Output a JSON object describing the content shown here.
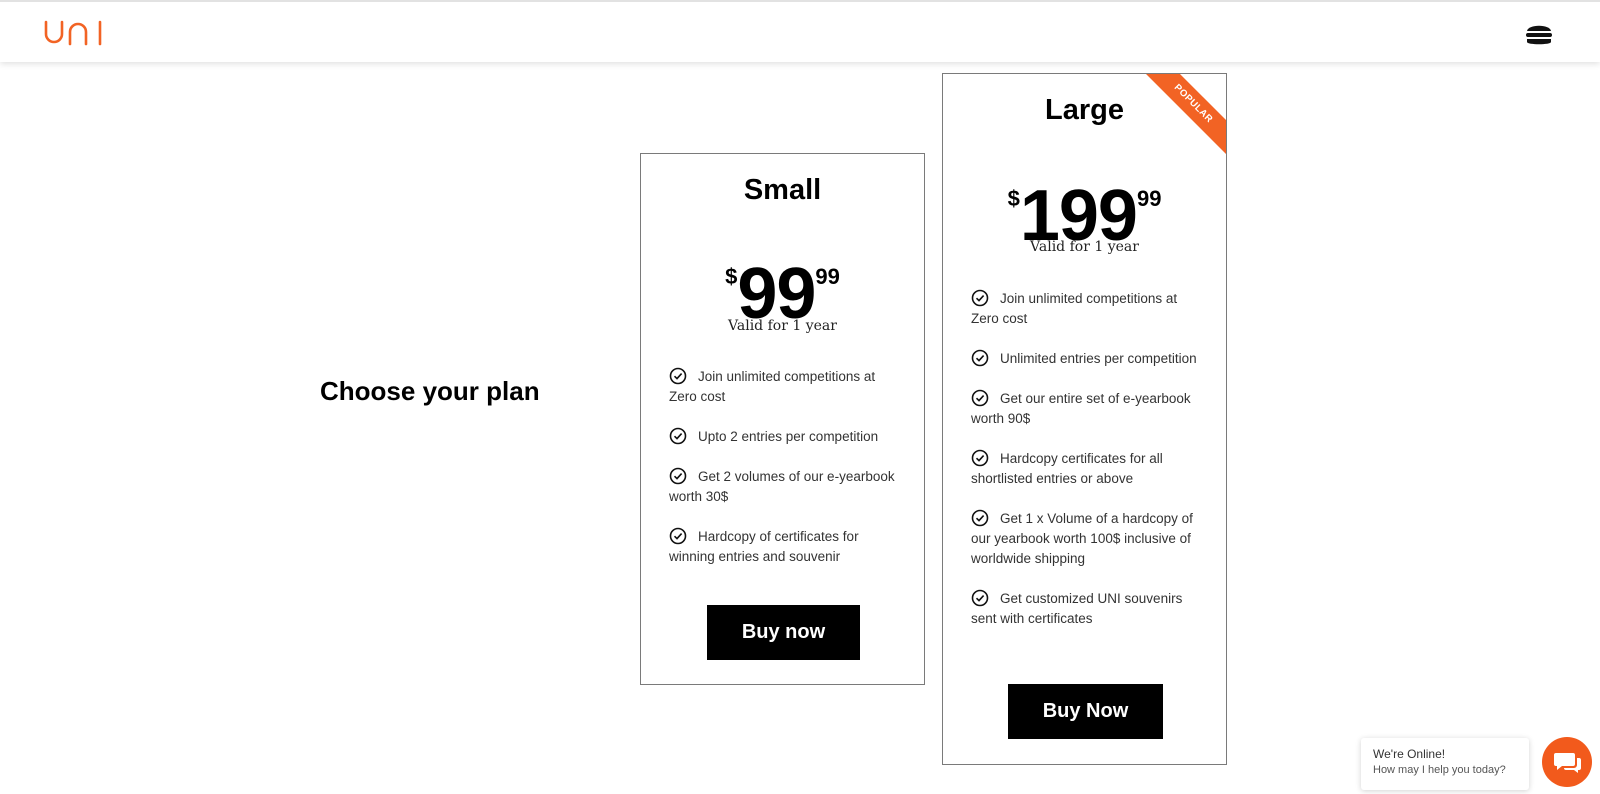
{
  "header": {
    "logo_text": "uni",
    "menu_icon": "hamburger-icon"
  },
  "heading": "Choose your plan",
  "plans": [
    {
      "name": "Small",
      "currency": "$",
      "price_main": "99",
      "price_cents": "99",
      "validity": "Valid for 1 year",
      "features": [
        "Join unlimited competitions at Zero cost",
        "Upto 2 entries per competition",
        "Get 2 volumes of our e-yearbook worth 30$",
        "Hardcopy of certificates for winning entries and souvenir"
      ],
      "button": "Buy now"
    },
    {
      "name": "Large",
      "badge": "POPULAR",
      "currency": "$",
      "price_main": "199",
      "price_cents": "99",
      "validity": "Valid for 1 year",
      "features": [
        "Join unlimited competitions at Zero cost",
        "Unlimited entries per competition",
        "Get our entire set of e-yearbook worth 90$",
        "Hardcopy certificates for all shortlisted entries or above",
        "Get 1 x Volume of a hardcopy of our yearbook worth 100$ inclusive of worldwide shipping",
        "Get customized UNI souvenirs sent with certificates"
      ],
      "button": "Buy Now"
    }
  ],
  "chat": {
    "title": "We're Online!",
    "subtitle": "How may I help you today?",
    "icon": "chat-icon"
  },
  "colors": {
    "accent": "#f26324",
    "button_bg": "#000000"
  }
}
